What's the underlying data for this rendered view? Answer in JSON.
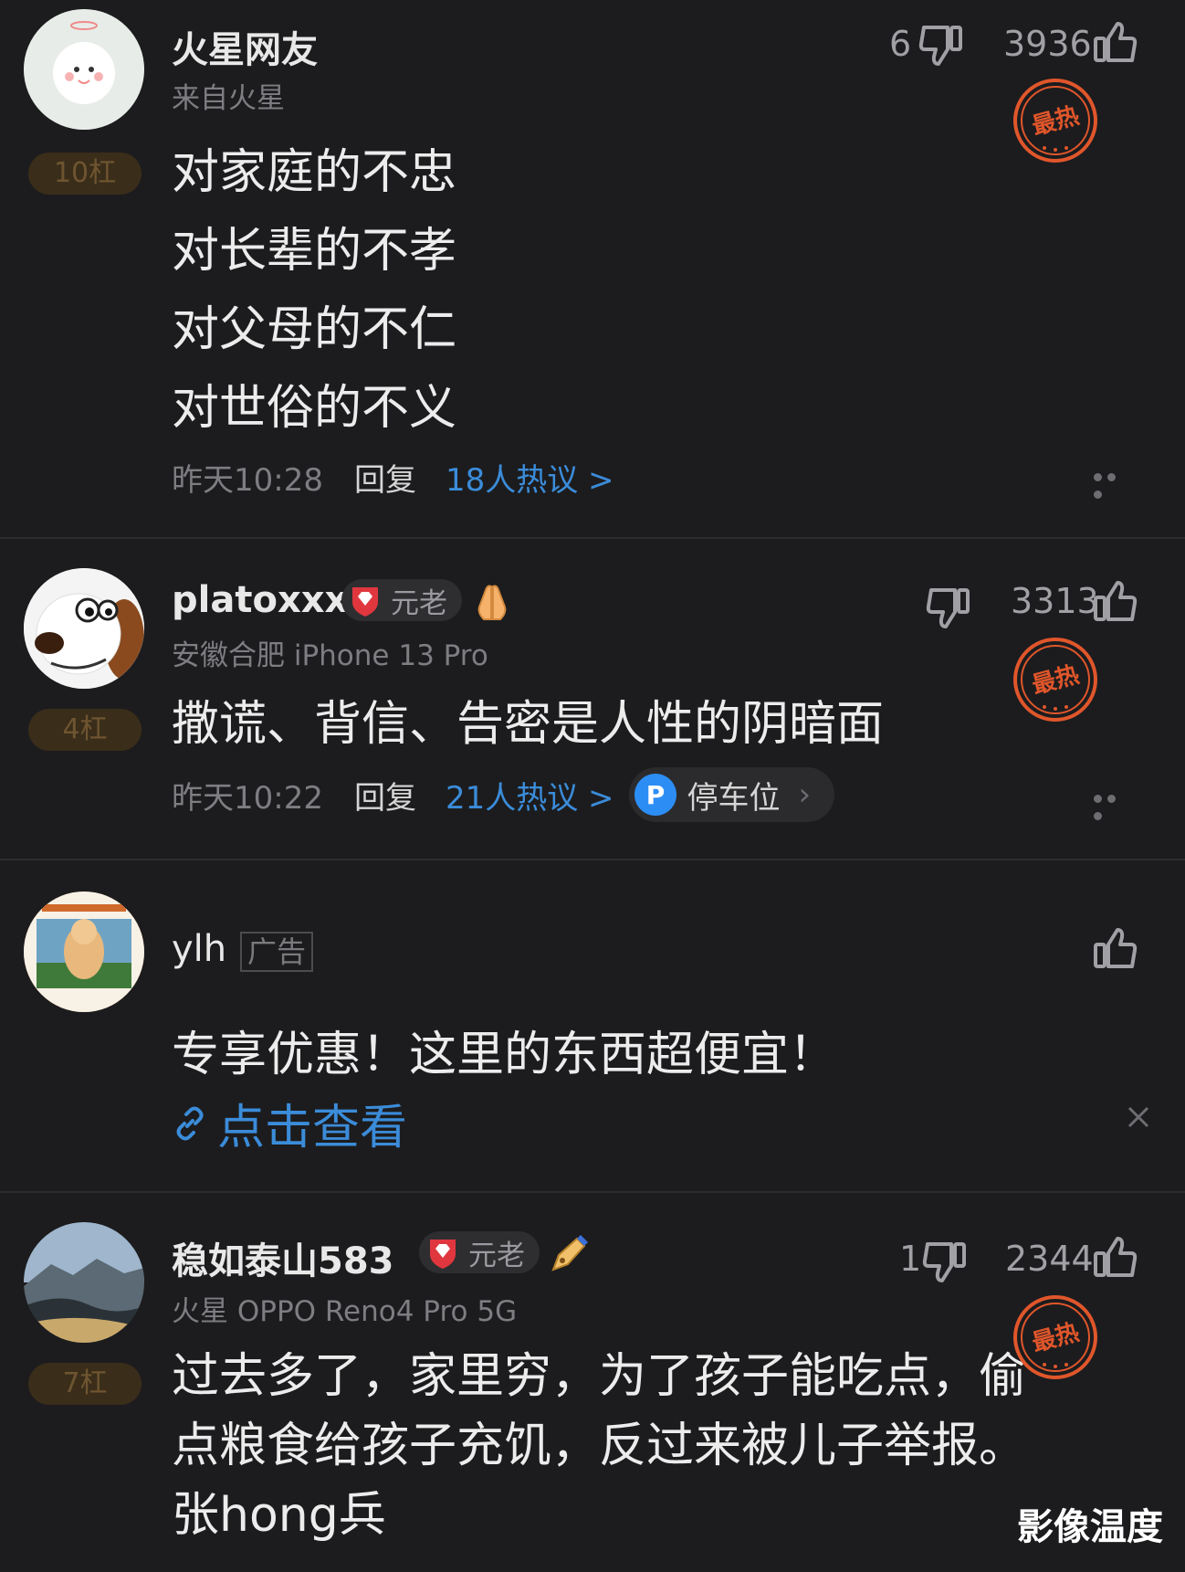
{
  "comments": [
    {
      "username": "火星网友",
      "subline": "来自火星",
      "rank": "10杠",
      "dislikes": "6",
      "likes": "3936",
      "hot_stamp": "最热",
      "lines": [
        "对家庭的不忠",
        "对长辈的不孝",
        "对父母的不仁",
        "对世俗的不义"
      ],
      "time": "昨天10:28",
      "reply": "回复",
      "hot_discussion": "18人热议 >"
    },
    {
      "username": "platoxxx",
      "badge": "元老",
      "subline": "安徽合肥  iPhone 13 Pro",
      "rank": "4杠",
      "dislikes": "",
      "likes": "3313",
      "hot_stamp": "最热",
      "text": "撒谎、背信、告密是人性的阴暗面",
      "time": "昨天10:22",
      "reply": "回复",
      "hot_discussion": "21人热议 >",
      "parking_label": "停车位",
      "parking_letter": "P"
    },
    {
      "username": "ylh",
      "ad_tag": "广告",
      "text": "专享优惠！这里的东西超便宜！",
      "link": "点击查看"
    },
    {
      "username": "稳如泰山583",
      "badge": "元老",
      "subline": "火星  OPPO Reno4 Pro 5G",
      "rank": "7杠",
      "dislikes": "1",
      "likes": "2344",
      "hot_stamp": "最热",
      "lines": [
        "过去多了，家里穷，为了孩子能吃点，偷",
        "点粮食给孩子充饥，反过来被儿子举报。",
        "张hong兵"
      ]
    }
  ],
  "watermark": "影像温度",
  "colors": {
    "link": "#3b8cd9",
    "stamp": "#e0562b",
    "background": "#1c1c1e"
  }
}
